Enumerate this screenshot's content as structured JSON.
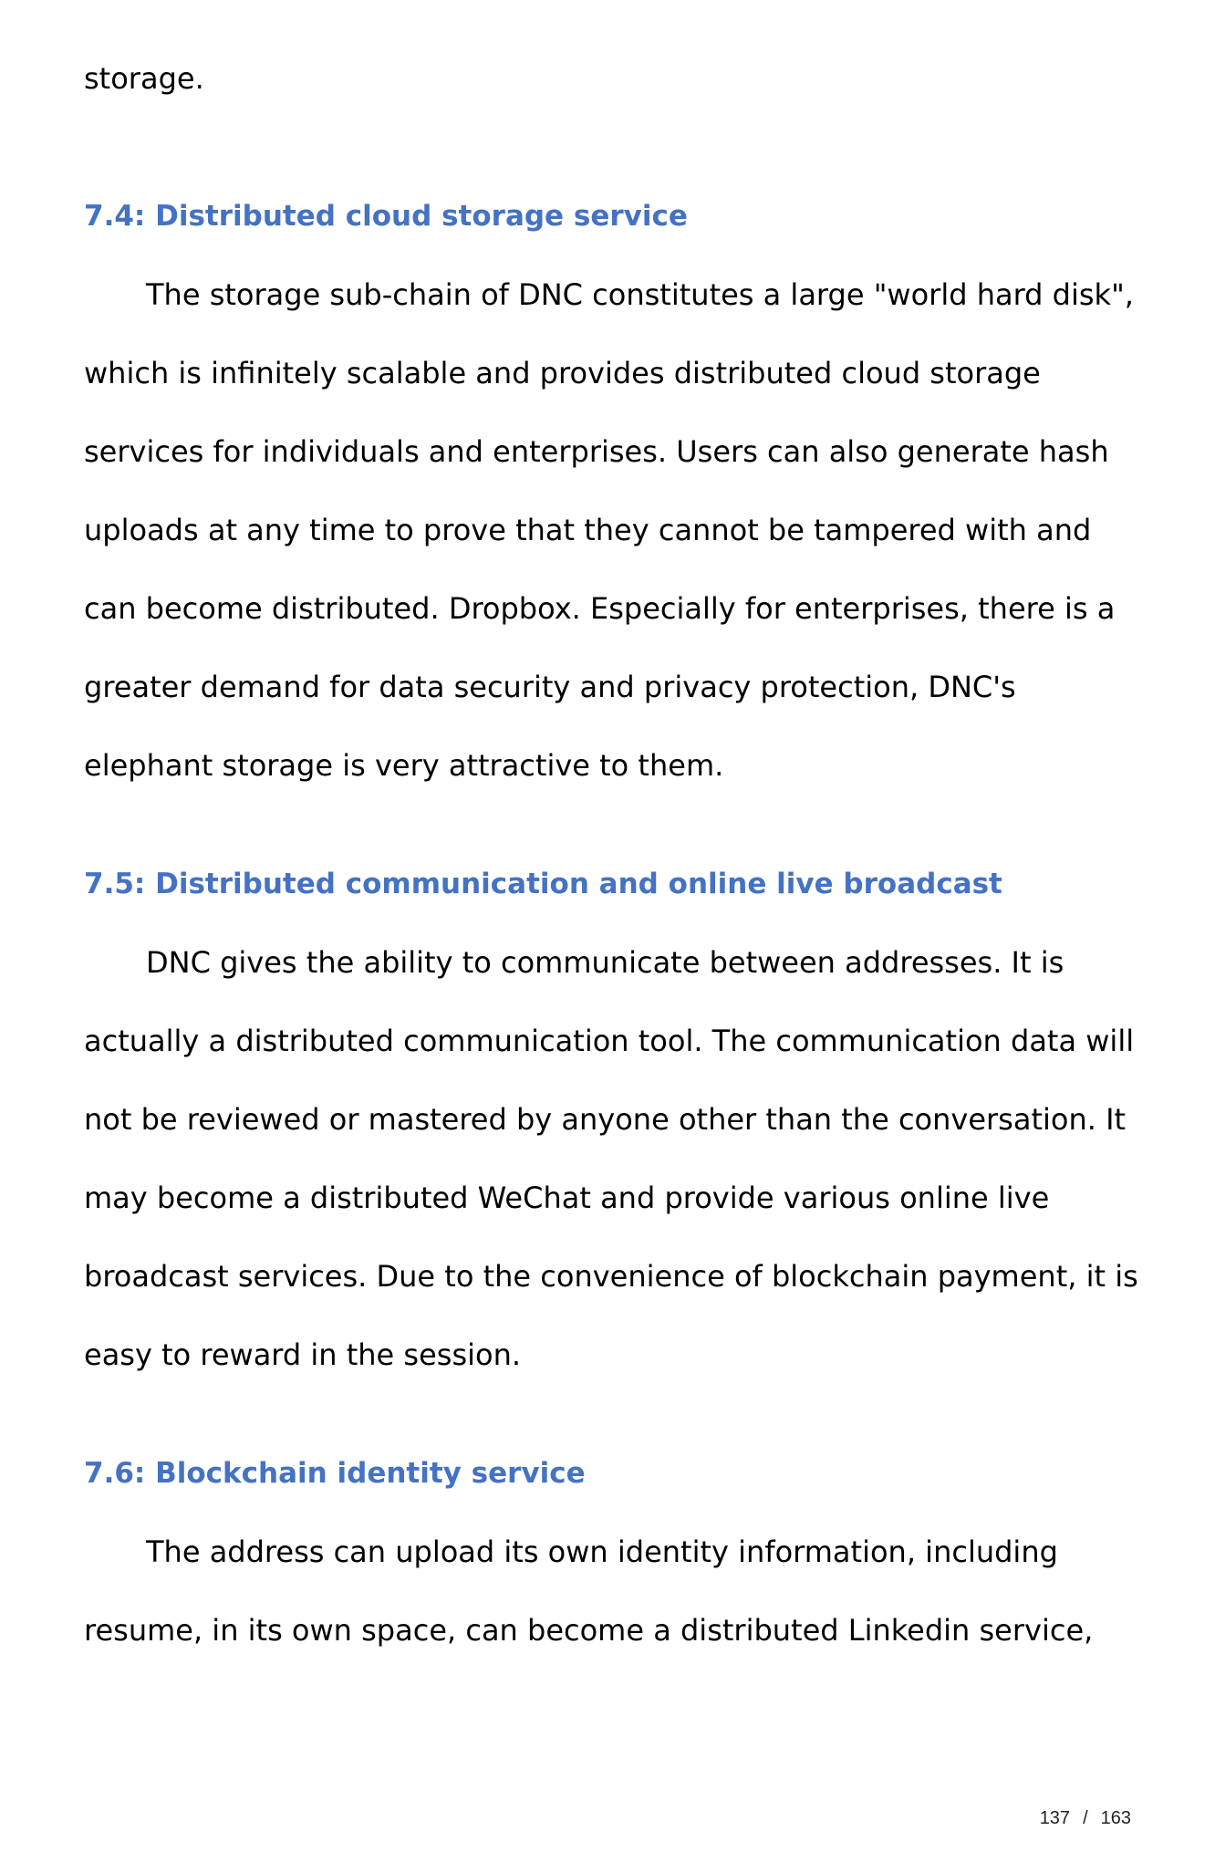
{
  "intro_tail": "storage.",
  "sections": [
    {
      "heading": "7.4: Distributed cloud storage service",
      "lines": [
        "The storage sub-chain of DNC constitutes a large \"world hard disk\",",
        "which is infinitely scalable and provides distributed cloud storage",
        "services for individuals and enterprises. Users can also generate hash",
        "uploads at any time to prove that they cannot be tampered with and",
        "can become distributed. Dropbox. Especially for enterprises, there is a",
        "greater demand for data security and privacy protection, DNC's",
        "elephant storage is very attractive to them."
      ]
    },
    {
      "heading": "7.5: Distributed communication and online live broadcast",
      "lines": [
        "DNC gives the ability to communicate between addresses. It is",
        "actually a distributed communication tool. The communication data will",
        "not be reviewed or mastered by anyone other than the conversation. It",
        "may become a distributed WeChat and provide various online live",
        "broadcast services. Due to the convenience of blockchain payment, it is",
        "easy to reward in the session."
      ]
    },
    {
      "heading": "7.6: Blockchain identity service",
      "lines": [
        "The address can upload its own identity information, including",
        "resume, in its own space, can become a distributed Linkedin service,"
      ]
    }
  ],
  "footer": {
    "current_page": "137",
    "separator": "/",
    "total_pages": "163"
  },
  "colors": {
    "heading": "#4472c4",
    "body_text": "#000000",
    "background": "#ffffff"
  }
}
